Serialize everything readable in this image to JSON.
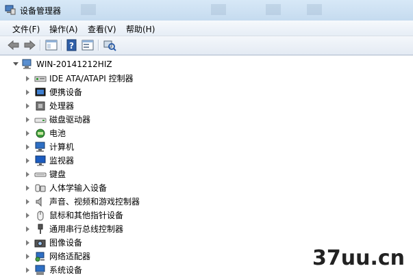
{
  "window": {
    "title": "设备管理器"
  },
  "menu": {
    "file": "文件(F)",
    "action": "操作(A)",
    "view": "查看(V)",
    "help": "帮助(H)"
  },
  "tree": {
    "root": "WIN-20141212HIZ",
    "items": [
      {
        "label": "IDE ATA/ATAPI 控制器",
        "icon": "ide-controller-icon"
      },
      {
        "label": "便携设备",
        "icon": "portable-device-icon"
      },
      {
        "label": "处理器",
        "icon": "processor-icon"
      },
      {
        "label": "磁盘驱动器",
        "icon": "disk-drive-icon"
      },
      {
        "label": "电池",
        "icon": "battery-icon"
      },
      {
        "label": "计算机",
        "icon": "computer-icon"
      },
      {
        "label": "监视器",
        "icon": "monitor-icon"
      },
      {
        "label": "键盘",
        "icon": "keyboard-icon"
      },
      {
        "label": "人体学输入设备",
        "icon": "hid-icon"
      },
      {
        "label": "声音、视频和游戏控制器",
        "icon": "sound-icon"
      },
      {
        "label": "鼠标和其他指针设备",
        "icon": "mouse-icon"
      },
      {
        "label": "通用串行总线控制器",
        "icon": "usb-icon"
      },
      {
        "label": "图像设备",
        "icon": "imaging-icon"
      },
      {
        "label": "网络适配器",
        "icon": "network-adapter-icon"
      },
      {
        "label": "系统设备",
        "icon": "system-device-icon"
      }
    ]
  },
  "watermark": {
    "text": "37uu.cn"
  }
}
